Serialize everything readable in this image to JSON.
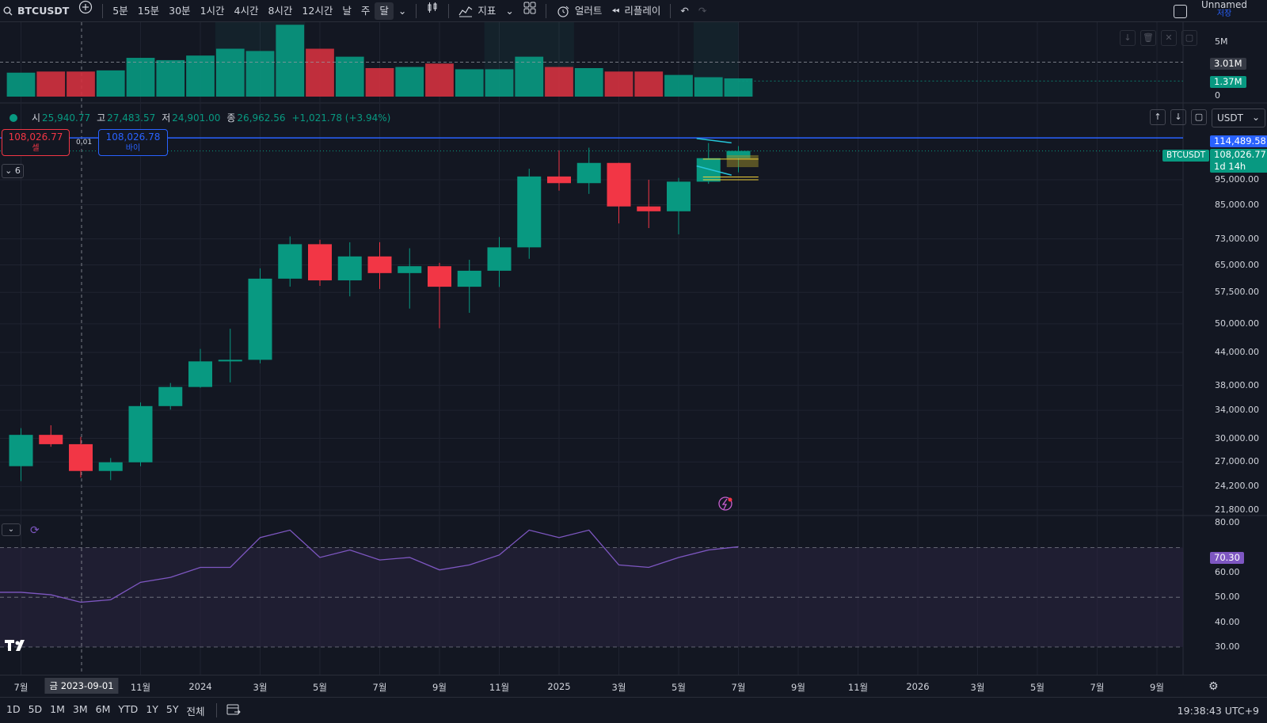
{
  "toolbar": {
    "symbol": "BTCUSDT",
    "intervals": [
      "5분",
      "15분",
      "30분",
      "1시간",
      "4시간",
      "8시간",
      "12시간",
      "날",
      "주",
      "달"
    ],
    "indicators_label": "지표",
    "alert_label": "얼러트",
    "replay_label": "리플레이",
    "user_name": "Unnamed",
    "save_label": "저장"
  },
  "legend": {
    "open_key": "시",
    "open": "25,940.77",
    "high_key": "고",
    "high": "27,483.57",
    "low_key": "저",
    "low": "24,901.00",
    "close_key": "종",
    "close": "26,962.56",
    "change": "+1,021.78 (+3.94%)"
  },
  "trade": {
    "sell_price": "108,026.77",
    "sell_label": "셀",
    "buy_price": "108,026.78",
    "buy_label": "바이",
    "spread": "0.01"
  },
  "currency": "USDT",
  "indicator_count": "6",
  "volume_axis": {
    "labels": [
      "5M",
      "3.01M",
      "1.37M",
      "0"
    ],
    "value_max": 5
  },
  "price_axis": {
    "labels": [
      "95,000.00",
      "85,000.00",
      "73,000.00",
      "65,000.00",
      "57,500.00",
      "50,000.00",
      "44,000.00",
      "38,000.00",
      "34,000.00",
      "30,000.00",
      "27,000.00",
      "24,200.00",
      "21,800.00"
    ],
    "alert_price": "114,489.58",
    "last_price": "108,026.77",
    "countdown": "1d 14h",
    "symbol_tag": "BTCUSDT"
  },
  "rsi_axis": {
    "labels": [
      "80.00",
      "60.00",
      "50.00",
      "40.00",
      "30.00"
    ],
    "current": "70.30"
  },
  "x_axis": {
    "labels": [
      "7월",
      "11월",
      "2024",
      "3월",
      "5월",
      "7월",
      "9월",
      "11월",
      "2025",
      "3월",
      "5월",
      "7월",
      "9월",
      "11월",
      "2026",
      "3월",
      "5월",
      "7월",
      "9월"
    ],
    "crosshair_label": "금 2023-09-01"
  },
  "ranges": [
    "1D",
    "5D",
    "1M",
    "3M",
    "6M",
    "YTD",
    "1Y",
    "5Y",
    "전체"
  ],
  "clock": "19:38:43 UTC+9",
  "chart_data": {
    "type": "candlestick",
    "candles": [
      {
        "date": "2023-06",
        "o": 26500,
        "h": 31400,
        "l": 24800,
        "c": 30470
      },
      {
        "date": "2023-07",
        "o": 30470,
        "h": 31800,
        "l": 28900,
        "c": 29230
      },
      {
        "date": "2023-08",
        "o": 29230,
        "h": 30200,
        "l": 25200,
        "c": 25940
      },
      {
        "date": "2023-09",
        "o": 25940,
        "h": 27483,
        "l": 24901,
        "c": 26962
      },
      {
        "date": "2023-10",
        "o": 26962,
        "h": 35200,
        "l": 26500,
        "c": 34640
      },
      {
        "date": "2023-11",
        "o": 34640,
        "h": 38400,
        "l": 34100,
        "c": 37720
      },
      {
        "date": "2023-12",
        "o": 37720,
        "h": 44700,
        "l": 37600,
        "c": 42280
      },
      {
        "date": "2024-01",
        "o": 42280,
        "h": 48900,
        "l": 38500,
        "c": 42580
      },
      {
        "date": "2024-02",
        "o": 42580,
        "h": 64000,
        "l": 41900,
        "c": 61130
      },
      {
        "date": "2024-03",
        "o": 61130,
        "h": 73800,
        "l": 59000,
        "c": 71280
      },
      {
        "date": "2024-04",
        "o": 71280,
        "h": 72700,
        "l": 59200,
        "c": 60670
      },
      {
        "date": "2024-05",
        "o": 60670,
        "h": 71900,
        "l": 56500,
        "c": 67500
      },
      {
        "date": "2024-06",
        "o": 67500,
        "h": 71900,
        "l": 58400,
        "c": 62670
      },
      {
        "date": "2024-07",
        "o": 62670,
        "h": 70000,
        "l": 53500,
        "c": 64620
      },
      {
        "date": "2024-08",
        "o": 64620,
        "h": 65600,
        "l": 49000,
        "c": 58970
      },
      {
        "date": "2024-09",
        "o": 58970,
        "h": 66500,
        "l": 52500,
        "c": 63330
      },
      {
        "date": "2024-10",
        "o": 63330,
        "h": 73600,
        "l": 58900,
        "c": 70290
      },
      {
        "date": "2024-11",
        "o": 70290,
        "h": 99800,
        "l": 66800,
        "c": 96400
      },
      {
        "date": "2024-12",
        "o": 96400,
        "h": 108300,
        "l": 90500,
        "c": 93580
      },
      {
        "date": "2025-01",
        "o": 93580,
        "h": 109600,
        "l": 89200,
        "c": 102400
      },
      {
        "date": "2025-02",
        "o": 102400,
        "h": 102500,
        "l": 78200,
        "c": 84350
      },
      {
        "date": "2025-03",
        "o": 84350,
        "h": 95000,
        "l": 76600,
        "c": 82550
      },
      {
        "date": "2025-04",
        "o": 82550,
        "h": 95800,
        "l": 74500,
        "c": 94200
      },
      {
        "date": "2025-05",
        "o": 94200,
        "h": 111900,
        "l": 93300,
        "c": 104600
      },
      {
        "date": "2025-06",
        "o": 104600,
        "h": 110400,
        "l": 98200,
        "c": 108026
      }
    ],
    "volume": [
      2.1,
      2.2,
      2.2,
      2.3,
      3.4,
      3.2,
      3.6,
      4.2,
      4.0,
      6.3,
      4.2,
      3.5,
      2.5,
      2.6,
      2.9,
      2.4,
      2.4,
      3.5,
      2.6,
      2.5,
      2.2,
      2.2,
      1.9,
      1.7,
      1.6
    ],
    "rsi": [
      52,
      51,
      48,
      49,
      56,
      58,
      62,
      62,
      74,
      77,
      66,
      69,
      65,
      66,
      61,
      63,
      67,
      77,
      74,
      77,
      63,
      62,
      66,
      69,
      70.3
    ]
  }
}
